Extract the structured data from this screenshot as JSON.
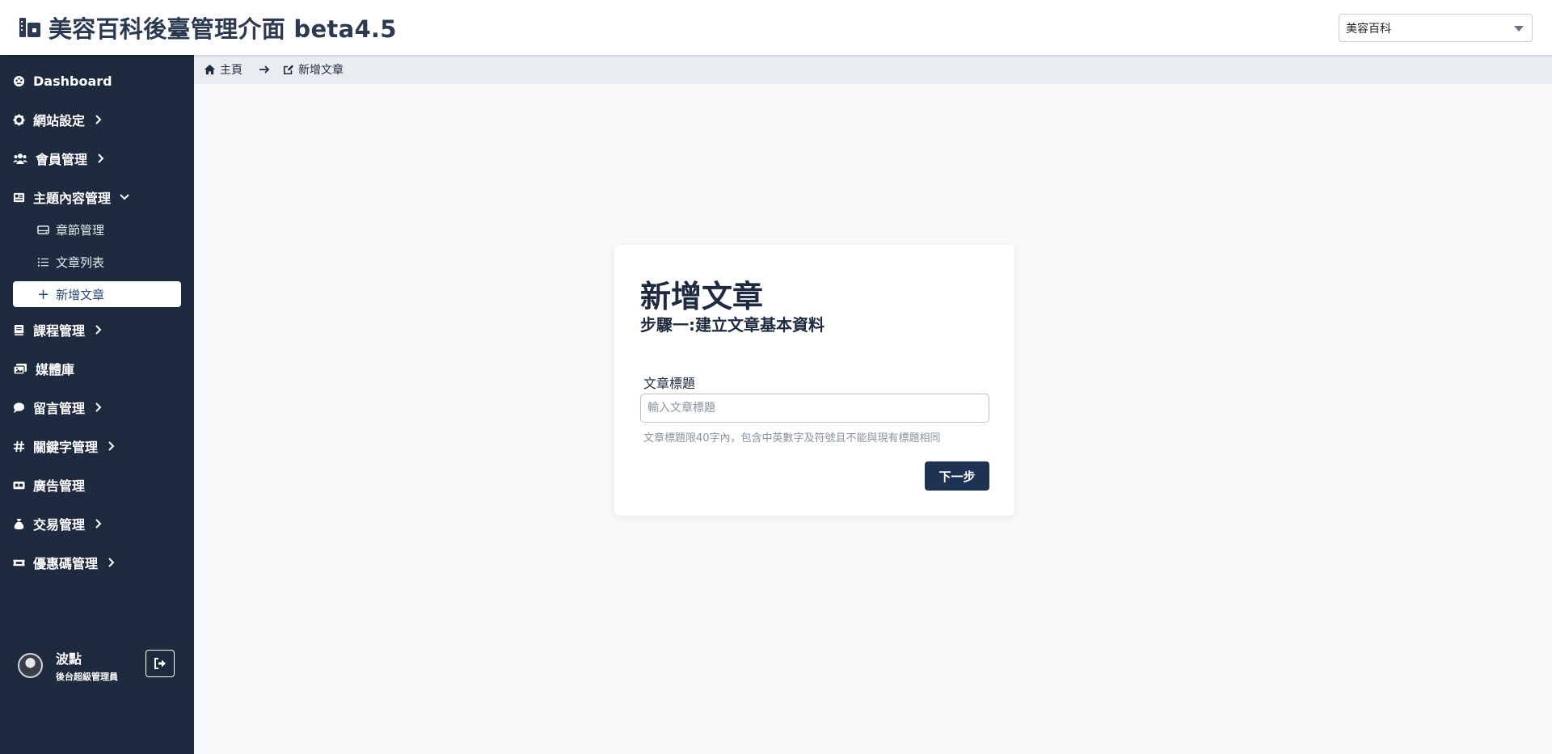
{
  "header": {
    "title": "美容百科後臺管理介面 beta4.5",
    "site_selector": "美容百科"
  },
  "sidebar": {
    "items": [
      {
        "label": "Dashboard",
        "icon": "palette-icon"
      },
      {
        "label": "網站設定",
        "icon": "gear-icon"
      },
      {
        "label": "會員管理",
        "icon": "users-icon"
      },
      {
        "label": "主題內容管理",
        "icon": "newspaper-icon"
      },
      {
        "label": "課程管理",
        "icon": "book-icon"
      },
      {
        "label": "媒體庫",
        "icon": "images-icon"
      },
      {
        "label": "留言管理",
        "icon": "comment-icon"
      },
      {
        "label": "關鍵字管理",
        "icon": "hashtag-icon"
      },
      {
        "label": "廣告管理",
        "icon": "rectangle-ad-icon"
      },
      {
        "label": "交易管理",
        "icon": "money-bag-icon"
      },
      {
        "label": "優惠碼管理",
        "icon": "ticket-icon"
      }
    ],
    "sub_items": [
      {
        "label": "章節管理",
        "icon": "hdd-icon"
      },
      {
        "label": "文章列表",
        "icon": "list-icon"
      },
      {
        "label": "新增文章",
        "icon": "plus-icon"
      }
    ],
    "user": {
      "name": "波點",
      "role": "後台超級管理員"
    }
  },
  "breadcrumb": {
    "home": "主頁",
    "current": "新增文章"
  },
  "card": {
    "title": "新增文章",
    "subtitle": "步驟一:建立文章基本資料",
    "field_label": "文章標題",
    "field_placeholder": "輸入文章標題",
    "field_value": "",
    "hint": "文章標題限40字內，包含中英數字及符號且不能與現有標題相同",
    "next_button": "下一步"
  },
  "colors": {
    "sidebar_bg": "#1e2a3d",
    "primary_button": "#1e3252",
    "breadcrumb_bg": "#e9edf2"
  }
}
